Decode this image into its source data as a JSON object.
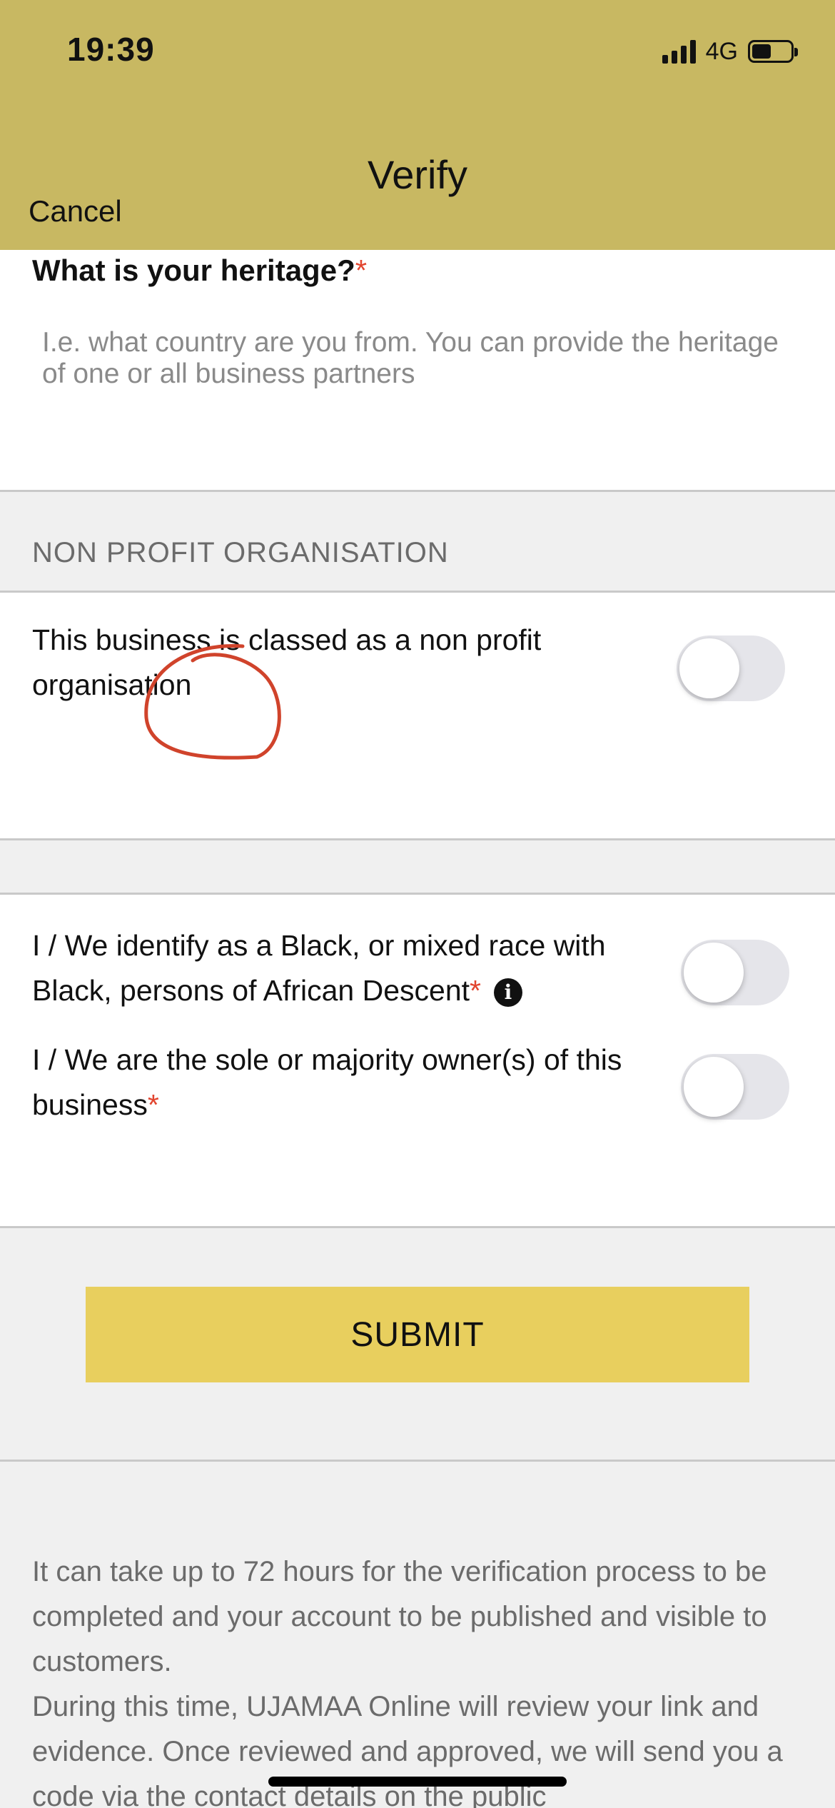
{
  "status_bar": {
    "time": "19:39",
    "network": "4G",
    "battery_level": 0.5
  },
  "nav": {
    "title": "Verify",
    "cancel_label": "Cancel"
  },
  "heritage": {
    "label": "What is your heritage?",
    "required_mark": "*",
    "placeholder": "I.e. what country are you from. You can provide the heritage of one or all business partners",
    "value": ""
  },
  "non_profit": {
    "section_header": "NON PROFIT ORGANISATION",
    "toggle_label": "This business is classed as a non profit organisation",
    "toggle_on": false
  },
  "identity": {
    "black_heritage_label": "I / We identify as a Black, or mixed race with Black, persons of African Descent",
    "black_heritage_required": "*",
    "black_heritage_on": false,
    "ownership_label": "I / We are the sole or majority owner(s) of this business",
    "ownership_required": "*",
    "ownership_on": false
  },
  "submit_label": "SUBMIT",
  "footer": {
    "paragraph1": "It can take up to 72 hours for the verification process to be completed and your account to be published and visible to customers.",
    "paragraph2": "During this time, UJAMAA Online will review your link and evidence. Once reviewed and approved, we will send you a code via the contact details on the public"
  },
  "colors": {
    "header_bg": "#c8b862",
    "submit_bg": "#e8cf5e",
    "required": "#e2452f",
    "annotation": "#d0432b"
  }
}
